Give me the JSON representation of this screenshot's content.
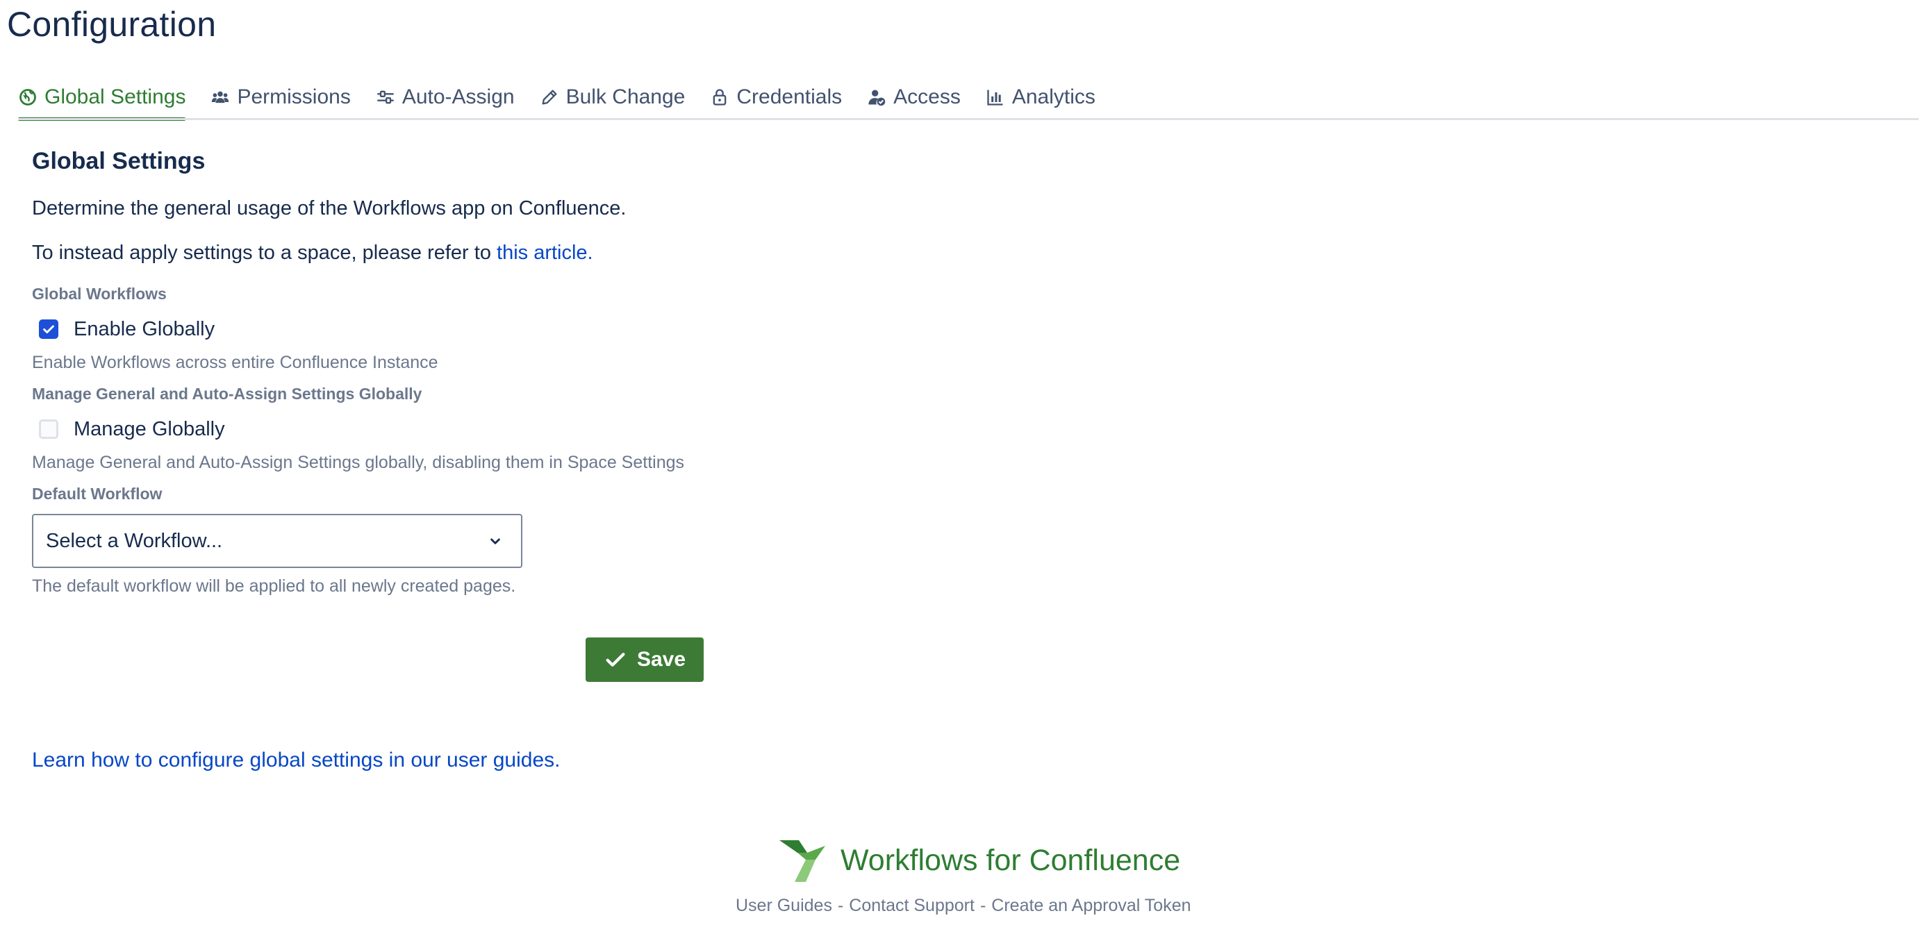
{
  "page": {
    "title": "Configuration"
  },
  "tabs": [
    {
      "label": "Global Settings",
      "icon": "globe-icon",
      "active": true
    },
    {
      "label": "Permissions",
      "icon": "users-icon",
      "active": false
    },
    {
      "label": "Auto-Assign",
      "icon": "sliders-icon",
      "active": false
    },
    {
      "label": "Bulk Change",
      "icon": "pencil-icon",
      "active": false
    },
    {
      "label": "Credentials",
      "icon": "lock-icon",
      "active": false
    },
    {
      "label": "Access",
      "icon": "user-check-icon",
      "active": false
    },
    {
      "label": "Analytics",
      "icon": "bar-chart-icon",
      "active": false
    }
  ],
  "global_settings": {
    "heading": "Global Settings",
    "description": "Determine the general usage of the Workflows app on Confluence.",
    "refer_text": "To instead apply settings to a space, please refer to ",
    "refer_link": "this article.",
    "global_workflows": {
      "label": "Global Workflows",
      "checkbox_label": "Enable Globally",
      "checked": true,
      "helper": "Enable Workflows across entire Confluence Instance"
    },
    "manage_globally": {
      "label": "Manage General and Auto-Assign Settings Globally",
      "checkbox_label": "Manage Globally",
      "checked": false,
      "helper": "Manage General and Auto-Assign Settings globally, disabling them in Space Settings"
    },
    "default_workflow": {
      "label": "Default Workflow",
      "placeholder": "Select a Workflow...",
      "helper": "The default workflow will be applied to all newly created pages."
    },
    "save_label": "Save"
  },
  "learn_link": "Learn how to configure global settings in our user guides.",
  "footer": {
    "brand": "Workflows for Confluence",
    "links": [
      "User Guides",
      "Contact Support",
      "Create an Approval Token"
    ],
    "separator": "-"
  },
  "colors": {
    "accent_green": "#2e7d32",
    "save_button": "#3d7a36",
    "link_blue": "#0747c6",
    "checkbox_blue": "#1d4fd8"
  }
}
